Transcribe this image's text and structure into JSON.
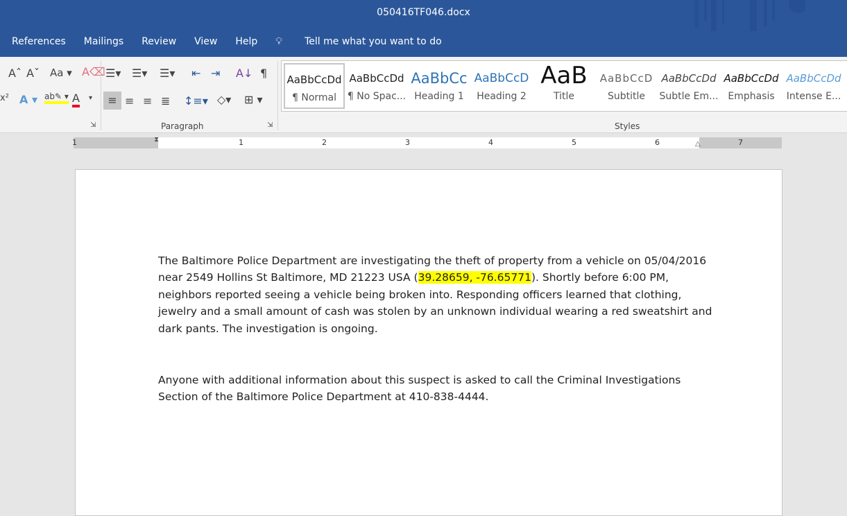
{
  "window": {
    "title": "050416TF046.docx"
  },
  "menu": {
    "items": [
      "References",
      "Mailings",
      "Review",
      "View",
      "Help"
    ],
    "tell_me": "Tell me what you want to do"
  },
  "ribbon": {
    "font_icons": [
      "grow-font",
      "shrink-font",
      "change-case",
      "clear-formatting",
      "superscript",
      "text-effects",
      "highlight",
      "font-color"
    ],
    "paragraph_label": "Paragraph",
    "styles_label": "Styles",
    "change_case_label": "Aa",
    "pilcrow": "¶",
    "styles": [
      {
        "preview": "AaBbCcDd",
        "name": "¶ Normal"
      },
      {
        "preview": "AaBbCcDd",
        "name": "¶ No Spac..."
      },
      {
        "preview": "AaBbCc",
        "name": "Heading 1"
      },
      {
        "preview": "AaBbCcD",
        "name": "Heading 2"
      },
      {
        "preview": "AaB",
        "name": "Title"
      },
      {
        "preview": "AaBbCcD",
        "name": "Subtitle"
      },
      {
        "preview": "AaBbCcDd",
        "name": "Subtle Em..."
      },
      {
        "preview": "AaBbCcDd",
        "name": "Emphasis"
      },
      {
        "preview": "AaBbCcDd",
        "name": "Intense E..."
      }
    ],
    "colors": {
      "highlight": "#ffff00",
      "font_color": "#e81123",
      "accent": "#2b579a"
    }
  },
  "ruler": {
    "labels": [
      "1",
      "1",
      "2",
      "3",
      "4",
      "5",
      "6",
      "7"
    ]
  },
  "document": {
    "p1_before": "The Baltimore Police Department are investigating the theft of property from a vehicle on 05/04/2016 near 2549 Hollins St Baltimore, MD 21223 USA (",
    "p1_highlight": "39.28659, -76.65771",
    "p1_after": "). Shortly before 6:00 PM, neighbors reported seeing a vehicle being broken into.  Responding officers learned that clothing, jewelry and a small amount of cash was stolen by an unknown individual wearing a red sweatshirt and dark pants. The investigation is ongoing.",
    "p2": "Anyone with additional information about this suspect is asked to call the Criminal Investigations Section of the Baltimore Police Department at 410-838-4444."
  }
}
